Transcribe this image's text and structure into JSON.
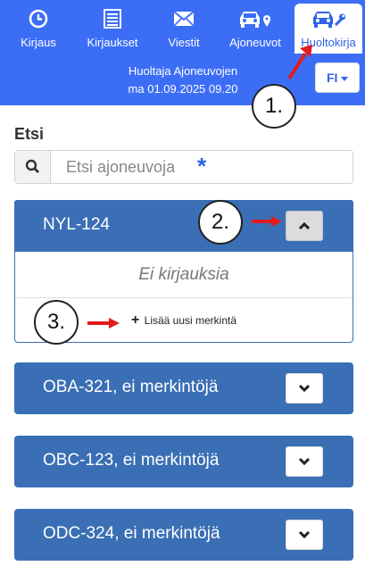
{
  "nav": {
    "items": [
      {
        "label": "Kirjaus",
        "icon": "clock-icon"
      },
      {
        "label": "Kirjaukset",
        "icon": "list-icon"
      },
      {
        "label": "Viestit",
        "icon": "envelope-icon"
      },
      {
        "label": "Ajoneuvot",
        "icon": "car-location-icon"
      },
      {
        "label": "Huoltokirja",
        "icon": "car-wrench-icon",
        "active": true
      }
    ]
  },
  "user": {
    "name": "Huoltaja Ajoneuvojen",
    "datetime": "ma 01.09.2025 09.20"
  },
  "language": {
    "selected": "FI"
  },
  "search": {
    "title": "Etsi",
    "placeholder": "Etsi ajoneuvoja",
    "required_mark": "*"
  },
  "vehicles": [
    {
      "title": "NYL-124",
      "expanded": true,
      "empty_text": "Ei kirjauksia",
      "add_label": "Lisää uusi merkintä"
    },
    {
      "title": "OBA-321, ei merkintöjä",
      "expanded": false
    },
    {
      "title": "OBC-123, ei merkintöjä",
      "expanded": false
    },
    {
      "title": "ODC-324, ei merkintöjä",
      "expanded": false
    }
  ],
  "annotations": {
    "callouts": [
      "1.",
      "2.",
      "3."
    ],
    "color": "#e01c1c"
  },
  "colors": {
    "header": "#3c6ef5",
    "card": "#3a6fb5",
    "accent": "#2f62e6"
  }
}
